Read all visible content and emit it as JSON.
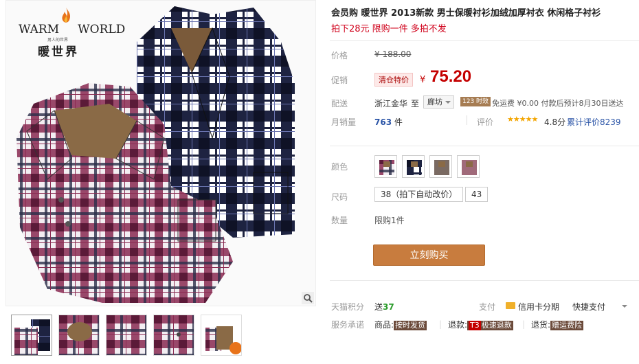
{
  "brand": {
    "en_left": "WARM",
    "en_right": "WORLD",
    "tagline": "男人的世界",
    "cn": "暖世界"
  },
  "product": {
    "title": "会员购 暖世界 2013新款 男士保暖衬衫加绒加厚衬衣 休闲格子衬衫",
    "subtitle": "拍下28元 限购一件 多拍不发"
  },
  "price_row": {
    "label": "价格",
    "original": "¥ 188.00"
  },
  "promo_row": {
    "label": "促销",
    "tag": "清仓特价",
    "currency": "¥",
    "price": "75.20"
  },
  "delivery_row": {
    "label": "配送",
    "from": "浙江金华",
    "to": "至",
    "city": "廊坊",
    "badge": "123 时效",
    "fee": "免运费 ¥0.00 付款后预计8月30日送达"
  },
  "sales_row": {
    "label": "月销量",
    "count": "763",
    "unit": "件",
    "review_label": "评价",
    "stars": "★★★★★",
    "rating": "4.8分",
    "review_count": "累计评价8239"
  },
  "color_row": {
    "label": "颜色",
    "swatches": [
      "purple-plaid",
      "grey-plaid",
      "brown-plaid",
      "red-plaid"
    ]
  },
  "size_row": {
    "label": "尺码",
    "options": [
      "38（拍下自动改价）",
      "43"
    ]
  },
  "qty_row": {
    "label": "数量",
    "text": "限购1件"
  },
  "buy_button": "立刻购买",
  "points_row": {
    "label": "天猫积分",
    "prefix": "送",
    "value": "37",
    "pay_label": "支付",
    "pay_opt1": "信用卡分期",
    "pay_opt2": "快捷支付"
  },
  "service_row": {
    "label": "服务承诺",
    "items": [
      {
        "prefix": "商品:",
        "tag": "按时发货"
      },
      {
        "prefix": "退款:",
        "tag_t3": "T3",
        "tag": "极速退款"
      },
      {
        "prefix": "退货:",
        "tag": "赠运费险"
      }
    ]
  },
  "colors": {
    "price_red": "#c40000",
    "buy_button": "#c87c3e",
    "link_blue": "#2953a6"
  }
}
